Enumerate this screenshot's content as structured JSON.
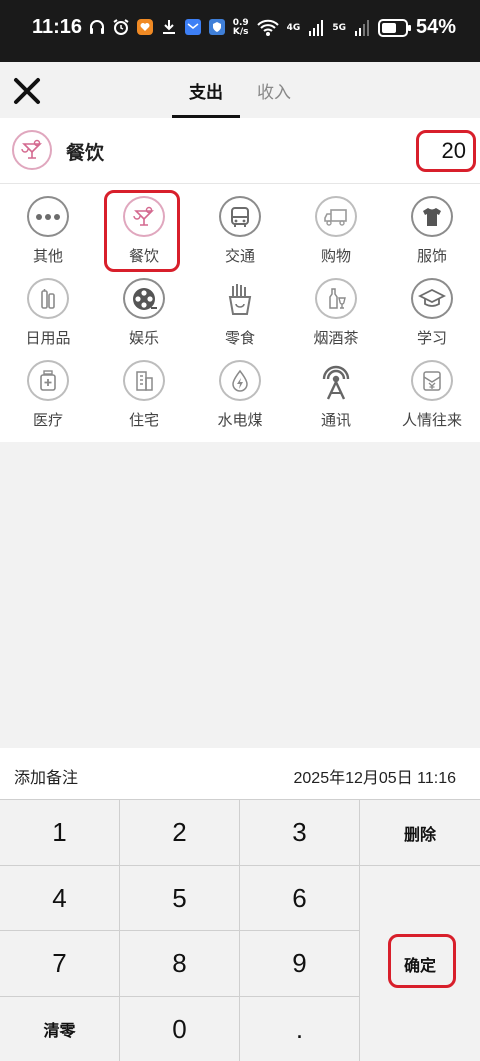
{
  "status_bar": {
    "time": "11:16",
    "net_speed_top": "0.9",
    "net_speed_bottom": "K/s",
    "network_4g": "4G",
    "network_5g": "5G",
    "battery": "54%"
  },
  "header": {
    "tabs": [
      {
        "label": "支出",
        "active": true
      },
      {
        "label": "收入",
        "active": false
      }
    ]
  },
  "selected": {
    "category": "餐饮",
    "amount": "20"
  },
  "categories": [
    {
      "label": "其他",
      "icon": "more-dots-icon"
    },
    {
      "label": "餐饮",
      "icon": "cocktail-icon"
    },
    {
      "label": "交通",
      "icon": "bus-icon"
    },
    {
      "label": "购物",
      "icon": "truck-icon"
    },
    {
      "label": "服饰",
      "icon": "tshirt-icon"
    },
    {
      "label": "日用品",
      "icon": "toiletries-icon"
    },
    {
      "label": "娱乐",
      "icon": "film-reel-icon"
    },
    {
      "label": "零食",
      "icon": "fries-icon"
    },
    {
      "label": "烟酒茶",
      "icon": "bottle-glass-icon"
    },
    {
      "label": "学习",
      "icon": "graduation-cap-icon"
    },
    {
      "label": "医疗",
      "icon": "medicine-icon"
    },
    {
      "label": "住宅",
      "icon": "building-icon"
    },
    {
      "label": "水电煤",
      "icon": "utilities-icon"
    },
    {
      "label": "通讯",
      "icon": "signal-tower-icon"
    },
    {
      "label": "人情往来",
      "icon": "red-envelope-icon"
    }
  ],
  "note": {
    "label": "添加备注",
    "datetime": "2025年12月05日 11:16"
  },
  "keypad": {
    "k1": "1",
    "k2": "2",
    "k3": "3",
    "k4": "4",
    "k5": "5",
    "k6": "6",
    "k7": "7",
    "k8": "8",
    "k9": "9",
    "k0": "0",
    "dot": ".",
    "delete": "删除",
    "confirm": "确定",
    "clear": "清零"
  },
  "colors": {
    "highlight": "#d81f2b",
    "pink_icon": "#e0a7be",
    "icon_gray": "#8c8c8c"
  }
}
